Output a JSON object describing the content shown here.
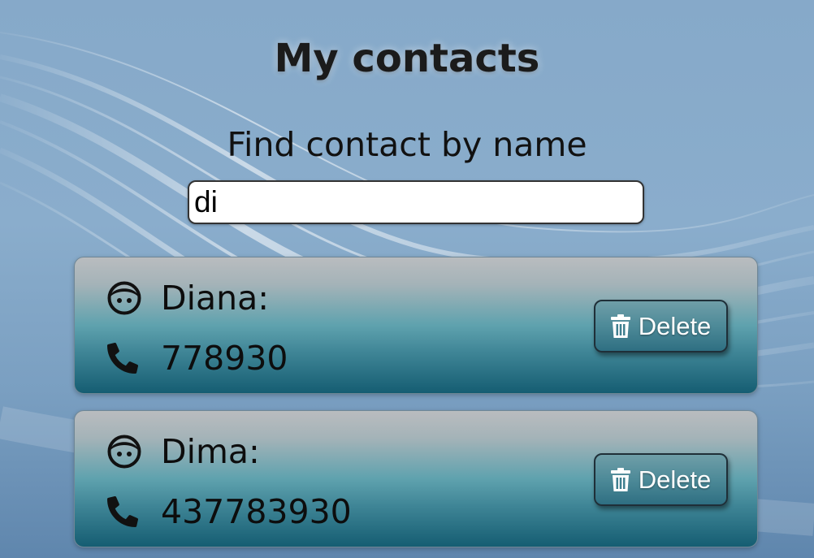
{
  "header": {
    "title": "My contacts"
  },
  "filter": {
    "label": "Find contact by name",
    "value": "di"
  },
  "contacts": [
    {
      "name": "Diana:",
      "phone": "778930",
      "delete_label": "Delete"
    },
    {
      "name": "Dima:",
      "phone": "437783930",
      "delete_label": "Delete"
    }
  ],
  "icons": {
    "person": "user-face-icon",
    "phone": "phone-icon",
    "delete": "trash-icon"
  },
  "colors": {
    "background": "#86a9c9",
    "card_top": "#b9bcbf",
    "card_bottom": "#155d72",
    "button": "#4d8a98",
    "text": "#111111"
  }
}
